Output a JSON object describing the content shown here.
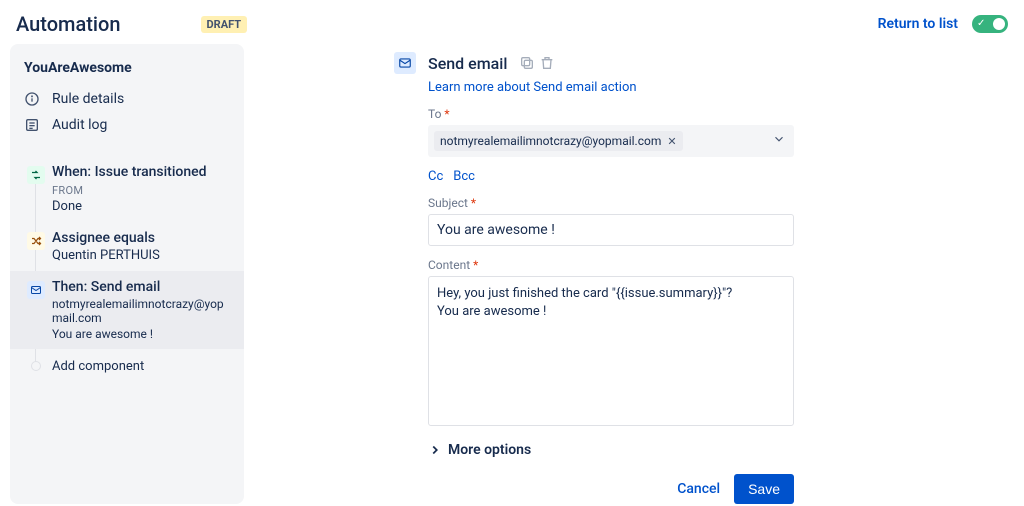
{
  "header": {
    "title": "Automation",
    "status_badge": "DRAFT",
    "return_label": "Return to list",
    "toggle_on": true
  },
  "sidebar": {
    "rule_name": "YouAreAwesome",
    "rule_details_label": "Rule details",
    "audit_log_label": "Audit log",
    "flow": {
      "trigger": {
        "title": "When: Issue transitioned",
        "from_label": "FROM",
        "from_value": "Done"
      },
      "condition": {
        "title": "Assignee equals",
        "value": "Quentin PERTHUIS"
      },
      "action": {
        "title": "Then: Send email",
        "line1": "notmyrealemailimnotcrazy@yopmail.com",
        "line2": "You are awesome !"
      },
      "add_component_label": "Add component"
    }
  },
  "main": {
    "title": "Send email",
    "learn_more": "Learn more about Send email action",
    "to": {
      "label": "To",
      "recipients": [
        "notmyrealemailimnotcrazy@yopmail.com"
      ]
    },
    "cc_label": "Cc",
    "bcc_label": "Bcc",
    "subject": {
      "label": "Subject",
      "value": "You are awesome !"
    },
    "content": {
      "label": "Content",
      "value": "Hey, you just finished the card \"{{issue.summary}}\"?\nYou are awesome !"
    },
    "more_options_label": "More options",
    "cancel_label": "Cancel",
    "save_label": "Save"
  }
}
